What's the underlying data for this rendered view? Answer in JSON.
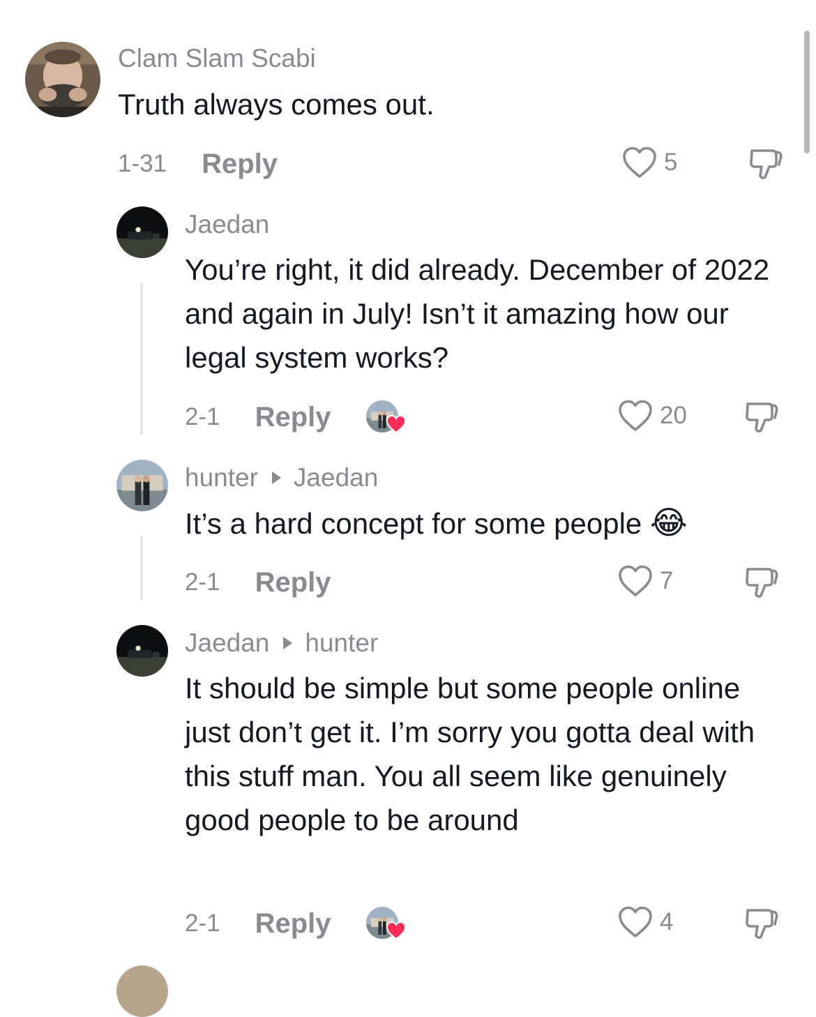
{
  "comments": [
    {
      "username": "Clam Slam Scabi",
      "reply_to": "",
      "text": "Truth always comes out.",
      "date": "1-31",
      "reply_label": "Reply",
      "likes": "5",
      "creator_liked": false
    },
    {
      "username": "Jaedan",
      "reply_to": "",
      "text": "You’re right, it did already. December of 2022 and again in July! Isn’t it amazing how our legal system works?",
      "date": "2-1",
      "reply_label": "Reply",
      "likes": "20",
      "creator_liked": true
    },
    {
      "username": "hunter",
      "reply_to": "Jaedan",
      "text": "It’s a hard concept for some people",
      "emoji": "😂",
      "date": "2-1",
      "reply_label": "Reply",
      "likes": "7",
      "creator_liked": false
    },
    {
      "username": "Jaedan",
      "reply_to": "hunter",
      "text": "It should be simple but some people online just don’t get it. I’m sorry you gotta deal with this stuff man. You all seem like genuinely good people to be around",
      "date": "2-1",
      "reply_label": "Reply",
      "likes": "4",
      "creator_liked": true
    }
  ],
  "icons": {
    "like": "heart-outline-icon",
    "dislike": "thumbs-down-icon",
    "creator_like": "creator-liked-icon",
    "reply_arrow": "triangle-right-icon"
  },
  "colors": {
    "text": "#161823",
    "muted": "#8a8b91",
    "heart_red": "#fe2c55"
  }
}
